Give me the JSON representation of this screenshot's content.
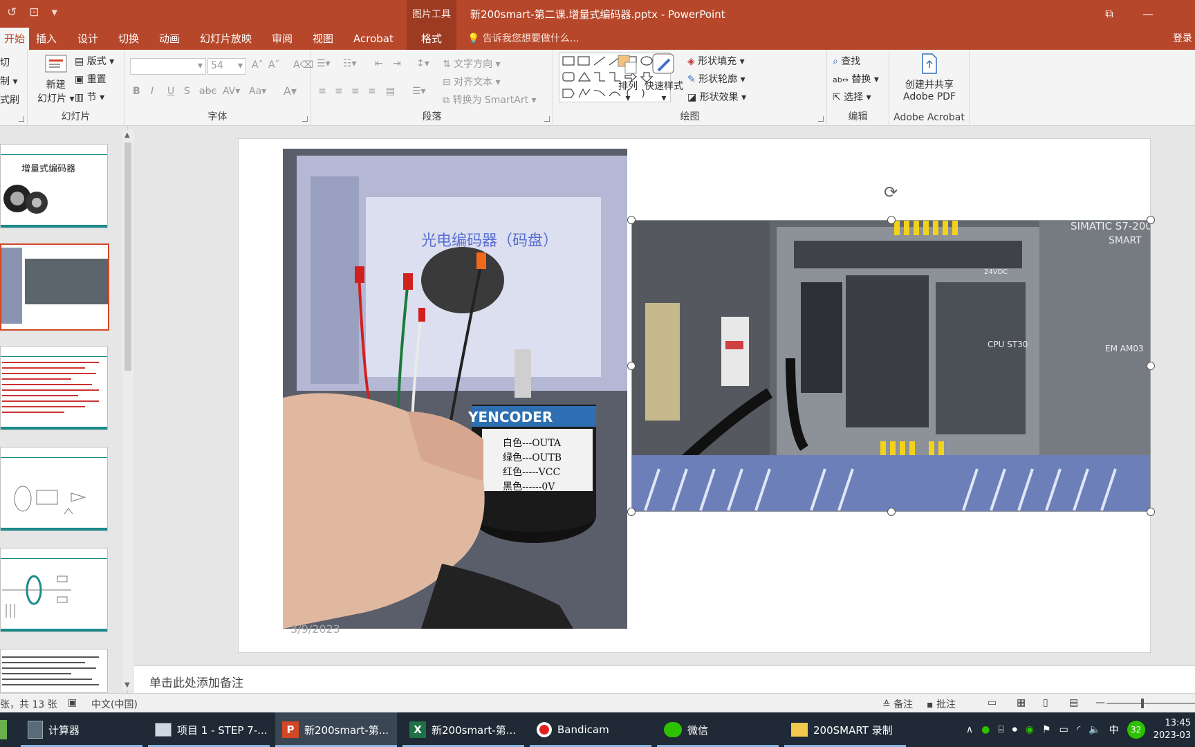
{
  "titlebar": {
    "context_group": "图片工具",
    "document_title": "新200smart-第二课.增量式编码器.pptx - PowerPoint"
  },
  "tabs": [
    {
      "label": "开始",
      "active": true
    },
    {
      "label": "插入"
    },
    {
      "label": "设计"
    },
    {
      "label": "切换"
    },
    {
      "label": "动画"
    },
    {
      "label": "幻灯片放映"
    },
    {
      "label": "审阅"
    },
    {
      "label": "视图"
    },
    {
      "label": "Acrobat"
    },
    {
      "label": "格式"
    }
  ],
  "tell_me": "告诉我您想要做什么...",
  "login": "登录",
  "ribbon": {
    "clipboard": {
      "cut": "切",
      "copy": "制",
      "painter": "式刷"
    },
    "slides": {
      "label": "幻灯片",
      "new_slide_1": "新建",
      "new_slide_2": "幻灯片",
      "layout": "版式",
      "reset": "重置",
      "section": "节"
    },
    "font": {
      "label": "字体",
      "size": "54"
    },
    "paragraph": {
      "label": "段落",
      "text_direction": "文字方向",
      "align_text": "对齐文本",
      "smartart": "转换为 SmartArt"
    },
    "drawing": {
      "label": "绘图",
      "arrange": "排列",
      "quick_styles": "快速样式",
      "shape_fill": "形状填充",
      "shape_outline": "形状轮廓",
      "shape_effects": "形状效果"
    },
    "editing": {
      "label": "编辑",
      "find": "查找",
      "replace": "替换",
      "select": "选择"
    },
    "acrobat": {
      "label": "Adobe Acrobat",
      "create_1": "创建并共享",
      "create_2": "Adobe PDF"
    }
  },
  "thumbnails": {
    "slide1_title": "增量式编码器"
  },
  "slide": {
    "date": "3/9/2023",
    "encoder_brand": "YENCODER",
    "encoder_lines": [
      "白色---OUTA",
      "绿色---OUTB",
      "红色-----VCC",
      "黑色------0V"
    ],
    "blurred_screen_title": "光电编码器（码盘）",
    "plc_brand_1": "SIMATIC S7-200",
    "plc_brand_2": "SMART",
    "plc_cpu": "CPU ST30",
    "plc_em": "EM AM03",
    "plc_24v": "24VDC"
  },
  "notes_placeholder": "单击此处添加备注",
  "status": {
    "slide_count": "张，共 13 张",
    "language": "中文(中国)",
    "notes": "备注",
    "comments": "批注"
  },
  "taskbar": {
    "items": [
      {
        "label": "计算器"
      },
      {
        "label": "项目 1 - STEP 7-..."
      },
      {
        "label": "新200smart-第..."
      },
      {
        "label": "新200smart-第..."
      },
      {
        "label": "Bandicam"
      },
      {
        "label": "微信"
      },
      {
        "label": "200SMART 录制"
      }
    ],
    "ime": "中",
    "badge": "32",
    "time": "13:45",
    "date": "2023-03"
  },
  "colors": {
    "accent": "#b7472a",
    "selection": "#d24726",
    "thumb_bar": "#1a8a8a"
  }
}
